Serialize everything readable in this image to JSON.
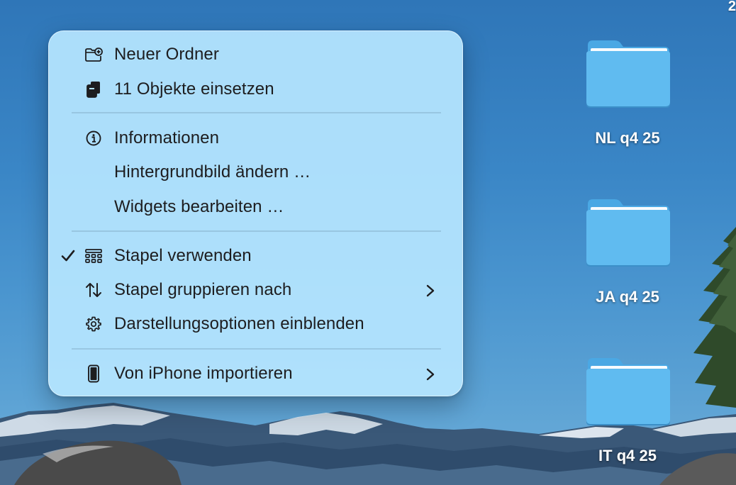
{
  "desktop": {
    "corner_text": "2"
  },
  "context_menu": {
    "items": [
      {
        "label": "Neuer Ordner",
        "icon": "new-folder-icon"
      },
      {
        "label": "11 Objekte einsetzen",
        "icon": "paste-icon"
      },
      {
        "label": "Informationen",
        "icon": "info-icon"
      },
      {
        "label": "Hintergrundbild ändern …",
        "icon": ""
      },
      {
        "label": "Widgets bearbeiten …",
        "icon": ""
      },
      {
        "label": "Stapel verwenden",
        "icon": "stacks-icon",
        "checked": true
      },
      {
        "label": "Stapel gruppieren nach",
        "icon": "sort-arrows-icon",
        "submenu": true
      },
      {
        "label": "Darstellungsoptionen einblenden",
        "icon": "gear-icon"
      },
      {
        "label": "Von iPhone importieren",
        "icon": "iphone-icon",
        "submenu": true
      }
    ]
  },
  "folders": [
    {
      "name": "NL q4 25"
    },
    {
      "name": "JA q4 25"
    },
    {
      "name": "IT q4 25"
    }
  ],
  "colors": {
    "menu_background": "#b6e6ff",
    "menu_text": "#1d1d1f",
    "folder_blue": "#5bb6ec",
    "sky": "#3a86c6"
  }
}
